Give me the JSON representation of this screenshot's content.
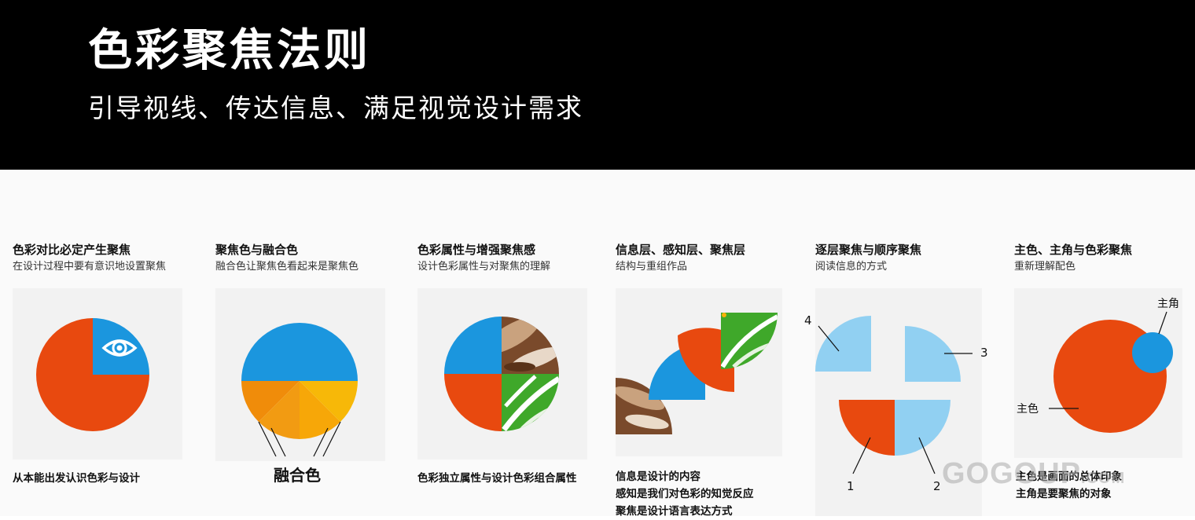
{
  "header": {
    "title": "色彩聚焦法则",
    "subtitle": "引导视线、传达信息、满足视觉设计需求"
  },
  "cards": [
    {
      "title": "色彩对比必定产生聚焦",
      "subtitle": "在设计过程中要有意识地设置聚焦",
      "notes": [
        "从本能出发认识色彩与设计"
      ],
      "icon": "eye-icon"
    },
    {
      "title": "聚焦色与融合色",
      "subtitle": "融合色让聚焦色看起来是聚焦色",
      "notes": [],
      "label": "融合色"
    },
    {
      "title": "色彩属性与增强聚焦感",
      "subtitle": "设计色彩属性与对聚焦的理解",
      "notes": [
        "色彩独立属性与设计色彩组合属性"
      ]
    },
    {
      "title": "信息层、感知层、聚焦层",
      "subtitle": "结构与重组作品",
      "notes": [
        "信息是设计的内容",
        "感知是我们对色彩的知觉反应",
        "聚焦是设计语言表达方式"
      ]
    },
    {
      "title": "逐层聚焦与顺序聚焦",
      "subtitle": "阅读信息的方式",
      "notes": [],
      "labels": [
        "4",
        "3",
        "1",
        "2"
      ]
    },
    {
      "title": "主色、主角与色彩聚焦",
      "subtitle": "重新理解配色",
      "notes": [
        "主色是画面的总体印象",
        "主角是要聚焦的对象"
      ],
      "labels": [
        "主角",
        "主色"
      ]
    }
  ],
  "watermark": {
    "main": "GOGOUP",
    "suffix": ".COM"
  },
  "colors": {
    "red": "#e8490f",
    "blue": "#1b96de",
    "light_blue": "#91d0f2",
    "orange": "#f08c0a",
    "yellow": "#f7b208",
    "green": "#3fa82a",
    "brown": "#7a4a2b",
    "panel_bg": "#f2f2f2",
    "header_bg": "#000000"
  }
}
